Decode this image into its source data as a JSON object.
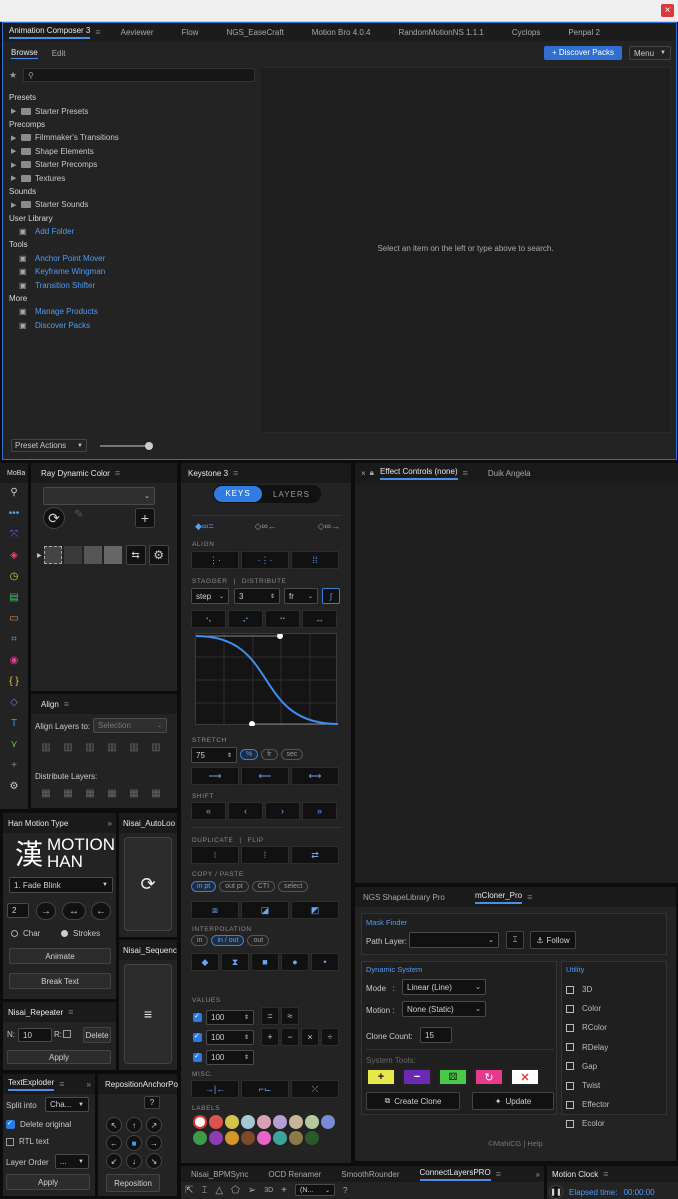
{
  "window": {
    "close_glyph": "×"
  },
  "top_tabs": [
    "Animation Composer 3",
    "Aeviewer",
    "Flow",
    "NGS_EaseCraft",
    "Motion Bro 4.0.4",
    "RandomMotionNS 1.1.1",
    "Cyclops",
    "Penpal 2"
  ],
  "ac": {
    "browse": "Browse",
    "edit": "Edit",
    "discover_packs_btn": "+ Discover Packs",
    "menu_btn": "Menu",
    "search_placeholder": "",
    "tree": [
      {
        "type": "header",
        "label": "Presets"
      },
      {
        "type": "folder",
        "label": "Starter Presets"
      },
      {
        "type": "header",
        "label": "Precomps"
      },
      {
        "type": "folder",
        "label": "Filmmaker's Transitions"
      },
      {
        "type": "folder",
        "label": "Shape Elements"
      },
      {
        "type": "folder",
        "label": "Starter Precomps"
      },
      {
        "type": "folder",
        "label": "Textures"
      },
      {
        "type": "header",
        "label": "Sounds"
      },
      {
        "type": "folder",
        "label": "Starter Sounds"
      },
      {
        "type": "header",
        "label": "User Library"
      },
      {
        "type": "link",
        "label": "Add Folder"
      },
      {
        "type": "header",
        "label": "Tools"
      },
      {
        "type": "link",
        "label": "Anchor Point Mover"
      },
      {
        "type": "link",
        "label": "Keyframe Wingman"
      },
      {
        "type": "link",
        "label": "Transition Shifter"
      },
      {
        "type": "header",
        "label": "More"
      },
      {
        "type": "link",
        "label": "Manage Products"
      },
      {
        "type": "link",
        "label": "Discover Packs"
      }
    ],
    "empty_message": "Select an item on the left or type above to search.",
    "preset_actions": "Preset Actions"
  },
  "moba": {
    "title": "MoBa"
  },
  "ray": {
    "title": "Ray Dynamic Color"
  },
  "align": {
    "title": "Align",
    "align_layers_to": "Align Layers to:",
    "selection": "Selection",
    "distribute_layers": "Distribute Layers:"
  },
  "han": {
    "title": "Han Motion Type",
    "logo_char": "漢",
    "logo_line1": "MOTION",
    "logo_line2": "HAN",
    "preset": "1. Fade Blink",
    "count": "2",
    "char": "Char",
    "strokes": "Strokes",
    "animate": "Animate",
    "break_text": "Break Text"
  },
  "nisai_autoloop": {
    "title": "Nisai_AutoLoo"
  },
  "nisai_sequence": {
    "title": "Nisai_Sequenc"
  },
  "nisai_repeater": {
    "title": "Nisai_Repeater",
    "n_label": "N:",
    "n_value": "10",
    "r_label": "R:",
    "delete": "Delete",
    "apply": "Apply"
  },
  "textexploder": {
    "title": "TextExploder",
    "split_into": "Split into",
    "split_value": "Cha...",
    "delete_original": "Delete original",
    "rtl_text": "RTL text",
    "layer_order": "Layer Order",
    "layer_order_value": "...",
    "apply": "Apply"
  },
  "reposition": {
    "title": "RepositionAnchorPo",
    "help": "?",
    "button": "Reposition"
  },
  "keystone": {
    "title": "Keystone 3",
    "keys": "KEYS",
    "layers": "LAYERS",
    "align": "ALIGN",
    "stagger": "STAGGER",
    "divider": "|",
    "distribute": "DISTRIBUTE",
    "step": "step",
    "step_value": "3",
    "unit": "fr",
    "stretch": "STRETCH",
    "stretch_value": "75",
    "stretch_units": [
      "%",
      "fr",
      "sec"
    ],
    "shift": "SHIFT",
    "duplicate": "DUPLICATE",
    "flip": "FLIP",
    "copy_paste": "COPY / PASTE",
    "copy_opts": [
      "in pt",
      "out pt",
      "CTI",
      "select"
    ],
    "interpolation": "INTERPOLATION",
    "interp_opts": [
      "in",
      "in / out",
      "out"
    ],
    "values": "VALUES",
    "value_rows": [
      "100",
      "100",
      "100"
    ],
    "misc": "MISC.",
    "labels": "LABELS",
    "label_colors": [
      "#d9534f",
      "#d4c34a",
      "#a6c8d4",
      "#d7a0b8",
      "#b4a0d4",
      "#c8b49a",
      "#b4c8a0",
      "#7a8cd4",
      "#3d9b4a",
      "#8c3db4",
      "#d4962a",
      "#7a4a2a",
      "#e864c8",
      "#3aa69b",
      "#8c7a4a",
      "#2a5a2a"
    ]
  },
  "effect_controls": {
    "title": "Effect Controls (none)",
    "duik": "Duik Angela"
  },
  "ngs_shape": {
    "title": "NGS ShapeLibrary Pro"
  },
  "mcloner": {
    "title": "mCloner_Pro",
    "mask_finder": "Mask Finder",
    "path_layer": "Path Layer:",
    "follow": "Follow",
    "dynamic_system": "Dynamic System",
    "mode_label": "Mode   :",
    "mode_value": "Linear (Line)",
    "motion_label": "Motion :",
    "motion_value": "None (Static)",
    "clone_count_label": "Clone Count:",
    "clone_count_value": "15",
    "system_tools": "System Tools:",
    "create_clone": "Create Clone",
    "update": "Update",
    "utility": "Utility",
    "utility_items": [
      "3D",
      "Color",
      "RColor",
      "RDelay",
      "Gap",
      "Twist",
      "Effector",
      "Ecolor"
    ],
    "footer": "©MahiCG | Help"
  },
  "bottom_tabs": [
    "Nisai_BPMSync",
    "OCD Renamer",
    "SmoothRounder",
    "ConnectLayersPRO"
  ],
  "bottom_dropdown": "(N...",
  "motion_clock": {
    "title": "Motion Clock",
    "elapsed": "Elapsed time:",
    "time": "00:00:00"
  }
}
